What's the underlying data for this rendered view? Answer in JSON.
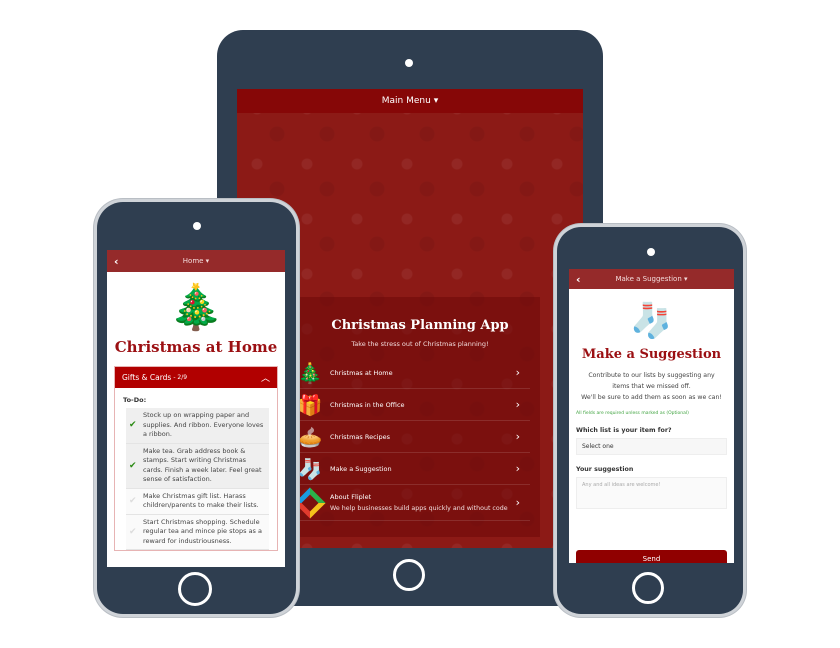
{
  "tablet": {
    "header": "Main Menu ▾",
    "title": "Christmas Planning App",
    "subtitle": "Take the stress out of Christmas planning!",
    "items": [
      {
        "label": "Christmas at Home",
        "icon": "tree-icon"
      },
      {
        "label": "Christmas in the Office",
        "icon": "gift-icon"
      },
      {
        "label": "Christmas Recipes",
        "icon": "pie-icon"
      },
      {
        "label": "Make a Suggestion",
        "icon": "stocking-icon"
      },
      {
        "label": "About Fliplet",
        "sublabel": "We help businesses build apps quickly and without code",
        "icon": "fliplet-logo-icon"
      }
    ]
  },
  "left_phone": {
    "header": "Home ▾",
    "title": "Christmas at Home",
    "accordion": {
      "title": "Gifts & Cards",
      "count": " - 2/9"
    },
    "todo_label": "To-Do:",
    "tasks": [
      {
        "text": "Stock up on wrapping paper and supplies. And ribbon. Everyone loves a ribbon.",
        "done": true
      },
      {
        "text": "Make tea. Grab address book & stamps. Start writing Christmas cards. Finish a week later. Feel great sense of satisfaction.",
        "done": true
      },
      {
        "text": "Make Christmas gift list. Harass children/parents to make their lists.",
        "done": false
      },
      {
        "text": "Start Christmas shopping. Schedule regular tea and mince pie stops as a reward for industriousness.",
        "done": false
      }
    ]
  },
  "right_phone": {
    "header": "Make a Suggestion ▾",
    "title": "Make a Suggestion",
    "intro1": "Contribute to our lists by suggesting any items that we missed off.",
    "intro2": "We'll be sure to add them as soon as we can!",
    "required_note": "All fields are required unless marked as (Optional)",
    "list_label": "Which list is your item for?",
    "list_value": "Select one",
    "suggestion_label": "Your suggestion",
    "suggestion_placeholder": "Any and all ideas are welcome!",
    "send": "Send"
  },
  "colors": {
    "device": "#2f3e50",
    "header": "#952a2a",
    "accent": "#b10000",
    "title": "#9b0f12"
  }
}
